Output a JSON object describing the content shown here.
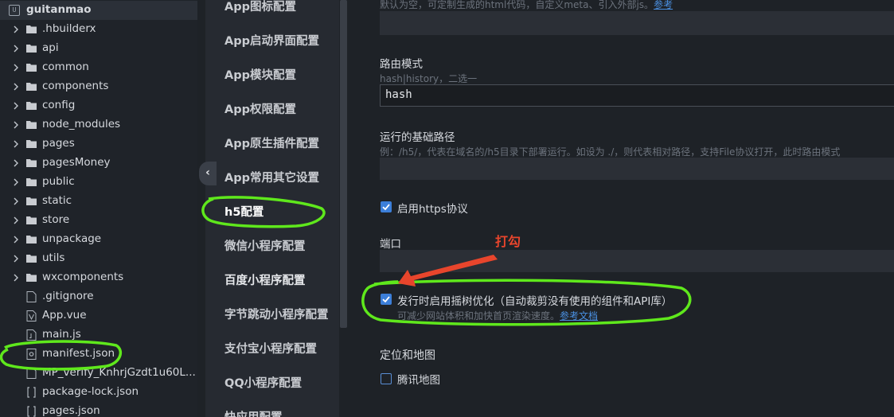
{
  "tree": {
    "root": "guitanmao",
    "root_icon": "project-icon",
    "folders": [
      ".hbuilderx",
      "api",
      "common",
      "components",
      "config",
      "node_modules",
      "pages",
      "pagesMoney",
      "public",
      "static",
      "store",
      "unpackage",
      "utils",
      "wxcomponents"
    ],
    "files": [
      {
        "name": ".gitignore",
        "icon": "file-icon"
      },
      {
        "name": "App.vue",
        "icon": "vue-file-icon"
      },
      {
        "name": "main.js",
        "icon": "js-file-icon"
      },
      {
        "name": "manifest.json",
        "icon": "settings-file-icon"
      },
      {
        "name": "MP_verify_KnhrjGzdt1u60L...",
        "icon": "file-icon"
      },
      {
        "name": "package-lock.json",
        "icon": "json-file-icon"
      },
      {
        "name": "pages.json",
        "icon": "json-file-icon"
      }
    ]
  },
  "nav": {
    "items": [
      "App图标配置",
      "App启动界面配置",
      "App模块配置",
      "App权限配置",
      "App原生插件配置",
      "App常用其它设置",
      "h5配置",
      "微信小程序配置",
      "百度小程序配置",
      "字节跳动小程序配置",
      "支付宝小程序配置",
      "QQ小程序配置",
      "快应用配置"
    ],
    "active_index": 6,
    "collapse_glyph": "‹"
  },
  "form": {
    "top_hint": "默认为空，可定制生成的html代码，自定义meta、引入外部js。",
    "top_hint_link": "参考",
    "router_mode": {
      "label": "路由模式",
      "hint": "hash|history，二选一",
      "value": "hash"
    },
    "base_path": {
      "label": "运行的基础路径",
      "hint": "例：/h5/，代表在域名的/h5目录下部署运行。如设为 ./，则代表相对路径，支持File协议打开，此时路由模式",
      "value": ""
    },
    "https": {
      "label": "启用https协议",
      "checked": true
    },
    "port": {
      "label": "端口",
      "value": ""
    },
    "treeshake": {
      "label": "发行时启用摇树优化（自动裁剪没有使用的组件和API库）",
      "hint": "可减少网站体积和加快首页渲染速度。",
      "hint_link": "参考文档",
      "checked": true
    },
    "location_section": "定位和地图",
    "tencent_map": {
      "label": "腾讯地图",
      "checked": false
    }
  },
  "annotation": {
    "text": "打勾",
    "arrow_color": "#e8452c",
    "highlight_color": "#5fe81c"
  }
}
